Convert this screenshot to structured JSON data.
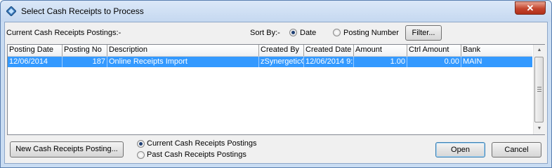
{
  "window": {
    "title": "Select Cash Receipts to Process",
    "close_symbol": "✕"
  },
  "toolbar": {
    "current_label": "Current Cash Receipts Postings:-",
    "sort_by_label": "Sort By:-",
    "sort_options": [
      {
        "label": "Date",
        "selected": true
      },
      {
        "label": "Posting Number",
        "selected": false
      }
    ],
    "filter_button": "Filter..."
  },
  "grid": {
    "columns": [
      "Posting Date",
      "Posting No",
      "Description",
      "Created By",
      "Created Date",
      "Amount",
      "Ctrl Amount",
      "Bank"
    ],
    "rows": [
      {
        "selected": true,
        "cells": [
          "12/06/2014",
          "187",
          "Online Receipts Import",
          "zSynergeticC",
          "12/06/2014 9:",
          "1.00",
          "0.00",
          "MAIN"
        ]
      }
    ],
    "scroll_up": "▲",
    "scroll_down": "▼"
  },
  "footer": {
    "new_button": "New Cash Receipts Posting...",
    "view_options": [
      {
        "label": "Current Cash Receipts Postings",
        "selected": true
      },
      {
        "label": "Past Cash Receipts Postings",
        "selected": false
      }
    ],
    "open_button": "Open",
    "cancel_button": "Cancel"
  },
  "colors": {
    "selection": "#3399ff",
    "titlebar": "#c5d8f0",
    "close_button": "#c4452d"
  }
}
